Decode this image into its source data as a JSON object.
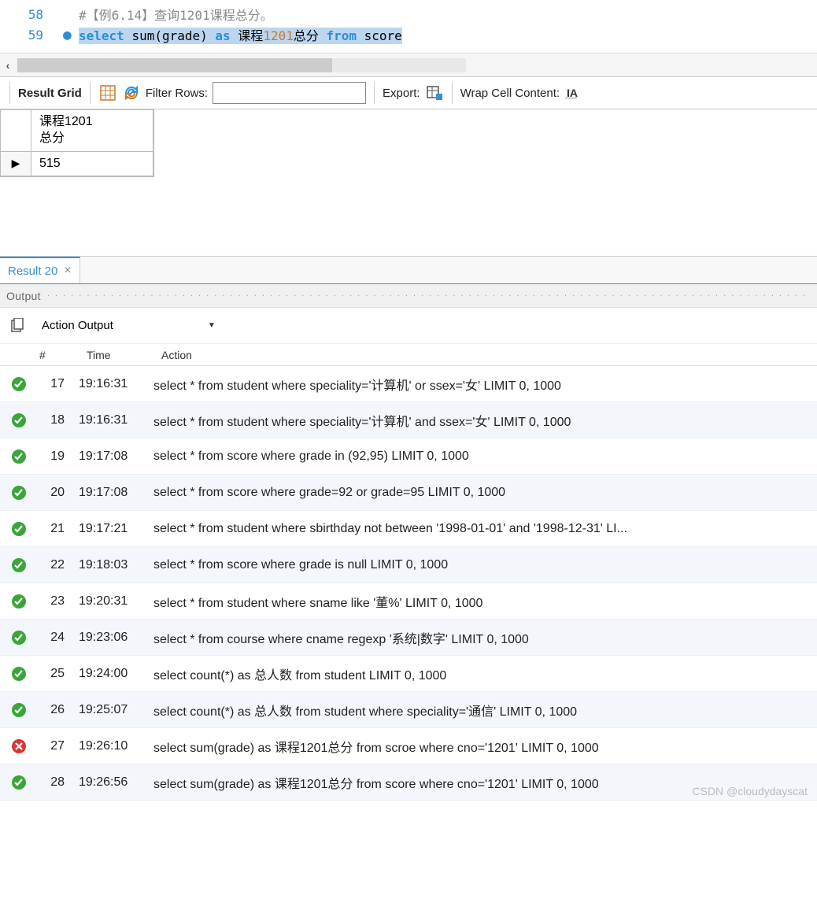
{
  "editor": {
    "lines": [
      {
        "num": "58",
        "bullet": "",
        "tokens": [
          {
            "cls": "tok-comment",
            "t": "#【例6.14】查询1201课程总分。"
          }
        ],
        "highlight": false
      },
      {
        "num": "59",
        "bullet": "●",
        "highlight": true,
        "tokens": [
          {
            "cls": "tok-keyword",
            "t": "select"
          },
          {
            "cls": "",
            "t": " "
          },
          {
            "cls": "tok-func",
            "t": "sum"
          },
          {
            "cls": "",
            "t": "(grade) "
          },
          {
            "cls": "tok-keyword",
            "t": "as"
          },
          {
            "cls": "",
            "t": " 课程"
          },
          {
            "cls": "tok-num",
            "t": "1201"
          },
          {
            "cls": "",
            "t": "总分 "
          },
          {
            "cls": "tok-keyword",
            "t": "from"
          },
          {
            "cls": "",
            "t": " score"
          }
        ]
      }
    ]
  },
  "toolbar": {
    "result_grid": "Result Grid",
    "filter_rows": "Filter Rows:",
    "filter_value": "",
    "export": "Export:",
    "wrap": "Wrap Cell Content:"
  },
  "result": {
    "header": "课程1201\n总分",
    "value": "515",
    "row_marker": "▶"
  },
  "tabs": {
    "label": "Result 20",
    "close": "×"
  },
  "output": {
    "title": "Output",
    "selector": "Action Output",
    "columns": {
      "num": "#",
      "time": "Time",
      "action": "Action"
    },
    "rows": [
      {
        "status": "ok",
        "num": "17",
        "time": "19:16:31",
        "action": "select * from student where speciality='计算机' or ssex='女' LIMIT 0, 1000"
      },
      {
        "status": "ok",
        "num": "18",
        "time": "19:16:31",
        "action": "select * from student where speciality='计算机' and ssex='女' LIMIT 0, 1000"
      },
      {
        "status": "ok",
        "num": "19",
        "time": "19:17:08",
        "action": "select * from score where grade in (92,95) LIMIT 0, 1000"
      },
      {
        "status": "ok",
        "num": "20",
        "time": "19:17:08",
        "action": "select * from score where grade=92 or grade=95 LIMIT 0, 1000"
      },
      {
        "status": "ok",
        "num": "21",
        "time": "19:17:21",
        "action": "select * from student where sbirthday not between '1998-01-01' and '1998-12-31' LI..."
      },
      {
        "status": "ok",
        "num": "22",
        "time": "19:18:03",
        "action": "select * from score where grade is null LIMIT 0, 1000"
      },
      {
        "status": "ok",
        "num": "23",
        "time": "19:20:31",
        "action": "select * from student where sname like '董%' LIMIT 0, 1000"
      },
      {
        "status": "ok",
        "num": "24",
        "time": "19:23:06",
        "action": "select * from course where cname regexp '系统|数字' LIMIT 0, 1000"
      },
      {
        "status": "ok",
        "num": "25",
        "time": "19:24:00",
        "action": "select count(*) as 总人数 from student LIMIT 0, 1000"
      },
      {
        "status": "ok",
        "num": "26",
        "time": "19:25:07",
        "action": "select count(*) as 总人数 from student  where speciality='通信' LIMIT 0, 1000"
      },
      {
        "status": "err",
        "num": "27",
        "time": "19:26:10",
        "action": "select sum(grade) as 课程1201总分 from scroe where cno='1201' LIMIT 0, 1000"
      },
      {
        "status": "ok",
        "num": "28",
        "time": "19:26:56",
        "action": "select sum(grade) as 课程1201总分 from score where cno='1201' LIMIT 0, 1000"
      }
    ]
  },
  "watermark": "CSDN @cloudydayscat"
}
